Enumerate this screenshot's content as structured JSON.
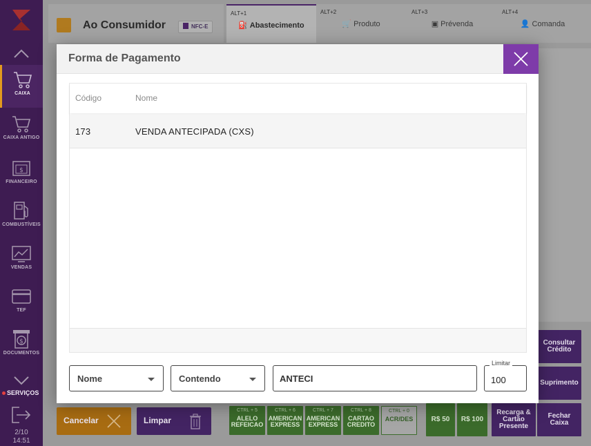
{
  "sidebar": {
    "items": [
      {
        "label": "CAIXA",
        "icon": "cart-icon"
      },
      {
        "label": "CAIXA ANTIGO",
        "icon": "cart-icon"
      },
      {
        "label": "FINANCEIRO",
        "icon": "money-icon"
      },
      {
        "label": "COMBUSTÍVEIS",
        "icon": "fuel-pump-icon"
      },
      {
        "label": "VENDAS",
        "icon": "chart-icon"
      },
      {
        "label": "TEF",
        "icon": "card-icon"
      },
      {
        "label": "DOCUMENTOS",
        "icon": "document-icon"
      }
    ],
    "servicos": "SERVIÇOS",
    "date": "2/10",
    "time": "14:51"
  },
  "customer": {
    "name": "Ao Consumidor",
    "badge": "NFC-E"
  },
  "tabs": [
    {
      "shortcut": "ALT+1",
      "label": "Abastecimento"
    },
    {
      "shortcut": "ALT+2",
      "label": "Produto"
    },
    {
      "shortcut": "ALT+3",
      "label": "Prévenda"
    },
    {
      "shortcut": "ALT+4",
      "label": "Comanda"
    }
  ],
  "actions": {
    "cancelar": "Cancelar",
    "limpar": "Limpar"
  },
  "shortcut_buttons": [
    {
      "key": "CTRL + 5",
      "label": "ALELO REFEICAO"
    },
    {
      "key": "CTRL + 6",
      "label": "AMERICAN EXPRESS"
    },
    {
      "key": "CTRL + 7",
      "label": "AMERICAN EXPRESS"
    },
    {
      "key": "CTRL + 8",
      "label": "CARTAO CREDITO"
    },
    {
      "key": "CTRL + 0",
      "label": "ACR/DES"
    }
  ],
  "value_buttons": [
    "R$ 50",
    "R$ 100"
  ],
  "right_buttons": {
    "consultar": "Consultar Crédito",
    "suprimento": "Suprimento",
    "recarga": "Recarga & Cartão Presente",
    "fechar": "Fechar Caixa"
  },
  "modal": {
    "title": "Forma de Pagamento",
    "columns": {
      "codigo": "Código",
      "nome": "Nome"
    },
    "rows": [
      {
        "codigo": "173",
        "nome": "VENDA ANTECIPADA (CXS)"
      }
    ],
    "filter_field": "Nome",
    "filter_mode": "Contendo",
    "search_value": "ANTECI",
    "limit_label": "Limitar",
    "limit_value": "100"
  },
  "colors": {
    "accent": "#7e3ba9",
    "sidebar": "#3e1c52",
    "active_marker": "#e39a1e"
  }
}
